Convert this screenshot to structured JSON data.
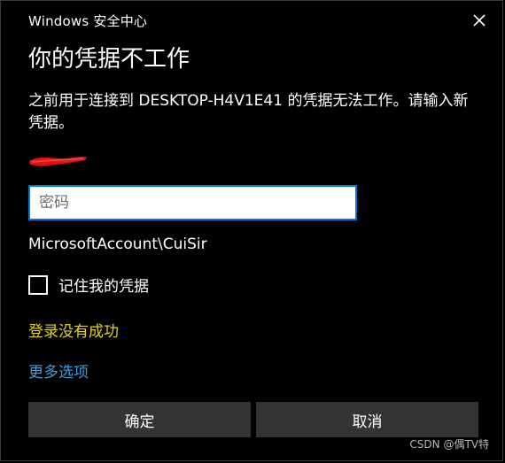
{
  "window": {
    "title": "Windows 安全中心",
    "close_icon": "close-icon"
  },
  "dialog": {
    "heading": "你的凭据不工作",
    "message": "之前用于连接到 DESKTOP-H4V1E41 的凭据无法工作。请输入新凭据。",
    "redacted_user_mark_color": "#e0101a"
  },
  "form": {
    "password_placeholder": "密码",
    "password_value": "",
    "account_name": "MicrosoftAccount\\CuiSir",
    "remember_label": "记住我的凭据",
    "remember_checked": false
  },
  "status": {
    "error_text": "登录没有成功",
    "error_color": "#e6d21b"
  },
  "links": {
    "more_options": "更多选项",
    "link_color": "#3a9ee0"
  },
  "buttons": {
    "ok_label": "确定",
    "cancel_label": "取消"
  },
  "watermark": {
    "text": "CSDN @偶TV特"
  },
  "colors": {
    "background": "#000000",
    "accent": "#0078d7",
    "button_bg": "#333333"
  }
}
